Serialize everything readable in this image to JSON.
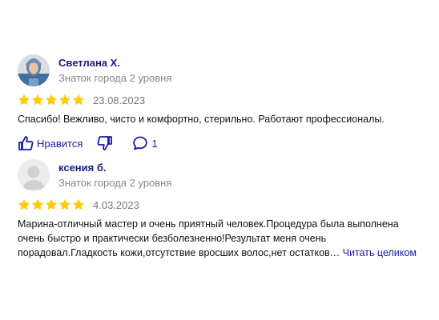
{
  "reviews": [
    {
      "author": "Светлана Х.",
      "level": "Знаток города 2 уровня",
      "rating": 5,
      "date": "23.08.2023",
      "text": "Спасибо! Вежливо, чисто и комфортно, стерильно. Работают профессионалы.",
      "like_label": "Нравится",
      "comments_count": "1",
      "icons": {
        "like": "thumbs-up-icon",
        "dislike": "thumbs-down-icon",
        "comment": "comment-bubble-icon"
      }
    },
    {
      "author": "ксения б.",
      "level": "Знаток города 2 уровня",
      "rating": 5,
      "date": "4.03.2023",
      "text": "Марина-отличный мастер и очень приятный человек.Процедура была выполнена очень быстро и практически безболезненно!Результат меня очень порадовал.Гладкость кожи,отсутствие вросших волос,нет остатков… ",
      "more_label": "Читать целиком"
    }
  ],
  "colors": {
    "star": "#ffcc00",
    "link": "#1a1aa6",
    "name": "#1a1a7a",
    "muted": "#888888"
  }
}
